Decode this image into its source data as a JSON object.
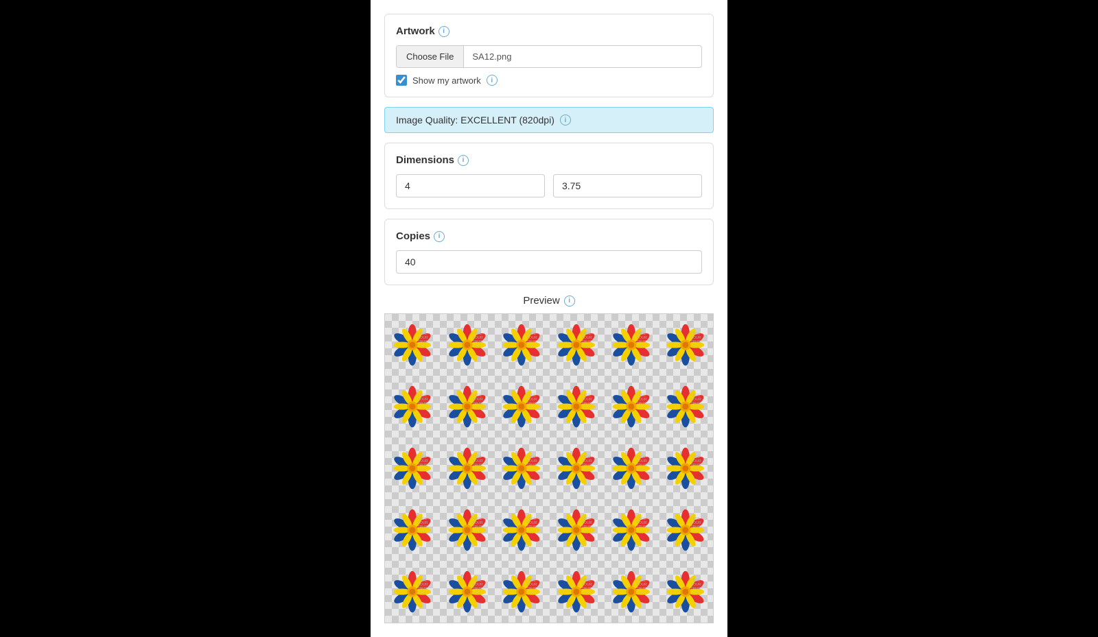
{
  "artwork": {
    "label": "Artwork",
    "file_label": "Choose File",
    "file_name": "SA12.png",
    "show_artwork_label": "Show my artwork",
    "show_artwork_checked": true,
    "info_icon": "ⓘ"
  },
  "quality": {
    "label": "Image Quality: EXCELLENT (820dpi)",
    "info_icon": "ⓘ"
  },
  "dimensions": {
    "label": "Dimensions",
    "width_value": "4",
    "height_value": "3.75",
    "info_icon": "ⓘ"
  },
  "copies": {
    "label": "Copies",
    "value": "40",
    "info_icon": "ⓘ"
  },
  "preview": {
    "label": "Preview",
    "info_icon": "ⓘ",
    "sticker_text_lines": [
      "I SEE",
      "YOUR",
      "TRUE",
      "colors"
    ]
  }
}
